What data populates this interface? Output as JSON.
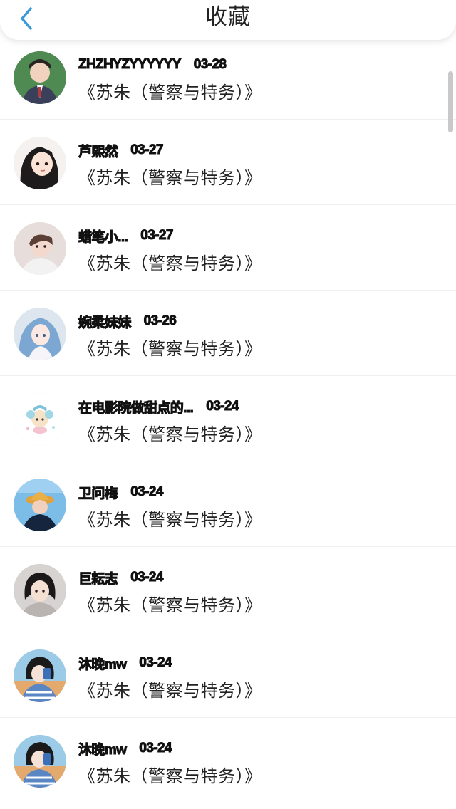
{
  "header": {
    "title": "收藏"
  },
  "accent_color": "#3a9ad9",
  "items": [
    {
      "name": "ZHZHYZYYYYYY",
      "date": "03-28",
      "book": "《苏朱（警察与特务）》",
      "avatar": "boy-in-school-uniform"
    },
    {
      "name": "芦熙然",
      "date": "03-27",
      "book": "《苏朱（警察与特务）》",
      "avatar": "cartoon-girl-long-hair"
    },
    {
      "name": "蜡笔小...",
      "date": "03-27",
      "book": "《苏朱（警察与特务）》",
      "avatar": "boy-portrait"
    },
    {
      "name": "婉柔妹妹",
      "date": "03-26",
      "book": "《苏朱（警察与特务）》",
      "avatar": "anime-girl-blue-hair"
    },
    {
      "name": "在电影院做甜点的...",
      "date": "03-24",
      "book": "《苏朱（警察与特务）》",
      "avatar": "cute-cartoon-sticker"
    },
    {
      "name": "卫问梅",
      "date": "03-24",
      "book": "《苏朱（警察与特务）》",
      "avatar": "person-in-yellow-hat"
    },
    {
      "name": "巨耘志",
      "date": "03-24",
      "book": "《苏朱（警察与特务）》",
      "avatar": "girl-short-black-hair"
    },
    {
      "name": "沐晚mw",
      "date": "03-24",
      "book": "《苏朱（警察与特务）》",
      "avatar": "cartoon-girl-with-phone"
    },
    {
      "name": "沐晚mw",
      "date": "03-24",
      "book": "《苏朱（警察与特务）》",
      "avatar": "cartoon-girl-with-phone"
    }
  ]
}
